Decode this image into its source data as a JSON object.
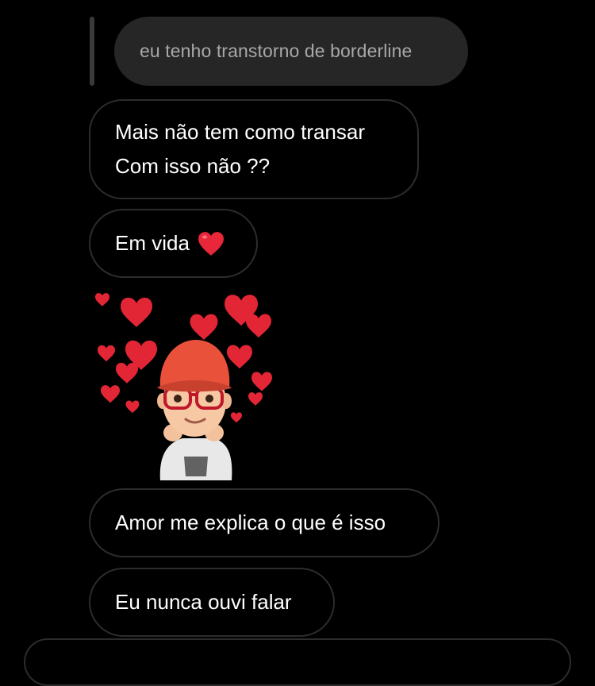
{
  "thread": {
    "quoted_reply": {
      "text": "eu tenho transtorno de borderline"
    },
    "messages": [
      {
        "lines": [
          "Mais não tem como transar",
          "Com isso não ??"
        ]
      },
      {
        "text": "Em vida",
        "emoji": "red-heart-icon"
      },
      {
        "sticker": "avatar-hearts-sticker"
      },
      {
        "text": "Amor me explica o que é isso"
      },
      {
        "text": "Eu nunca ouvi falar"
      }
    ]
  },
  "colors": {
    "background": "#000000",
    "quoted_bubble": "#262626",
    "quoted_text": "#a8a8a8",
    "bubble_border": "#2c2c2e",
    "message_text": "#ffffff",
    "heart": "#e8283a"
  }
}
